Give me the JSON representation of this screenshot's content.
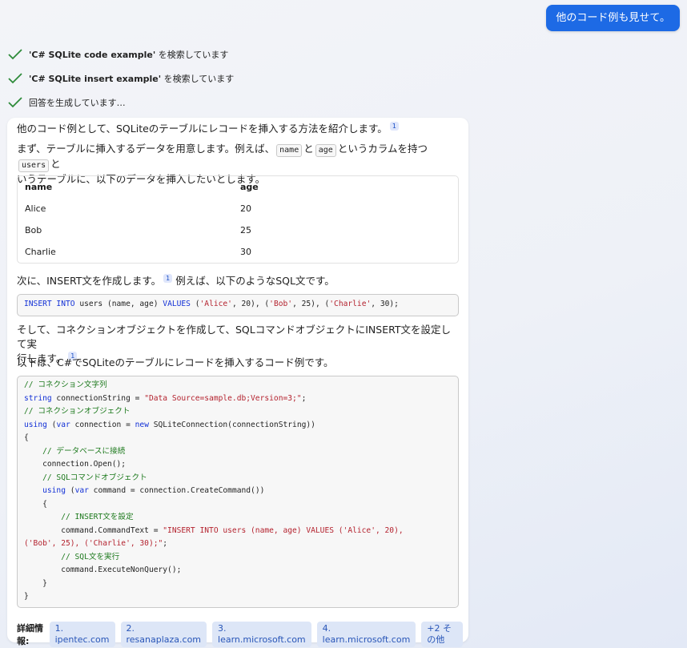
{
  "user_message": "他のコード例も見せて。",
  "status": [
    {
      "query": "'C# SQLite code example'",
      "suffix": " を検索しています"
    },
    {
      "query": "'C# SQLite insert example'",
      "suffix": " を検索しています"
    },
    {
      "query": "",
      "suffix": "回答を生成しています…"
    }
  ],
  "answer": {
    "intro": "他のコード例として、SQLiteのテーブルにレコードを挿入する方法を紹介します。",
    "cite": "1",
    "para2_a": "まず、テーブルに挿入するデータを用意します。例えば、",
    "para2_code1": "name",
    "para2_mid1": "と",
    "para2_code2": "age",
    "para2_mid2": "というカラムを持つ",
    "para2_code3": "users",
    "para2_b": "と",
    "para2_c": "いうテーブルに、以下のデータを挿入したいとします。",
    "table": {
      "headers": [
        "name",
        "age"
      ],
      "rows": [
        [
          "Alice",
          "20"
        ],
        [
          "Bob",
          "25"
        ],
        [
          "Charlie",
          "30"
        ]
      ]
    },
    "para3_a": "次に、INSERT文を作成します。",
    "para3_b": "例えば、以下のようなSQL文です。",
    "sql": {
      "kw1": "INSERT INTO",
      "t1": " users (name, age) ",
      "kw2": "VALUES",
      "t2": " (",
      "s1": "'Alice'",
      "t3": ", 20), (",
      "s2": "'Bob'",
      "t4": ", 25), (",
      "s3": "'Charlie'",
      "t5": ", 30);"
    },
    "para4_a": "そして、コネクションオブジェクトを作成して、SQLコマンドオブジェクトにINSERT文を設定して実",
    "para4_b": "行します。",
    "para5": "以下は、C#でSQLiteのテーブルにレコードを挿入するコード例です。",
    "code": {
      "l1": "// コネクション文字列",
      "l2_kw": "string",
      "l2_t": " connectionString = ",
      "l2_s": "\"Data Source=sample.db;Version=3;\"",
      "l2_e": ";",
      "l3": "// コネクションオブジェクト",
      "l4_kw1": "using",
      "l4_t1": " (",
      "l4_kw2": "var",
      "l4_t2": " connection = ",
      "l4_kw3": "new",
      "l4_t3": " SQLiteConnection(connectionString))",
      "l5": "{",
      "l6": "    // データベースに接続",
      "l7": "    connection.Open();",
      "l8": "    // SQLコマンドオブジェクト",
      "l9_i": "    ",
      "l9_kw1": "using",
      "l9_t1": " (",
      "l9_kw2": "var",
      "l9_t2": " command = connection.CreateCommand())",
      "l10": "    {",
      "l11": "        // INSERT文を設定",
      "l12_t": "        command.CommandText = ",
      "l12_s": "\"INSERT INTO users (name, age) VALUES ('Alice', 20),",
      "l13_s": "('Bob', 25), ('Charlie', 30);\"",
      "l13_e": ";",
      "l14": "        // SQL文を実行",
      "l15": "        command.ExecuteNonQuery();",
      "l16": "    }",
      "l17": "}"
    }
  },
  "more_info": {
    "label": "詳細情報:",
    "links": [
      "1. ipentec.com",
      "2. resanaplaza.com",
      "3. learn.microsoft.com",
      "4. learn.microsoft.com",
      "+2 その他"
    ]
  }
}
